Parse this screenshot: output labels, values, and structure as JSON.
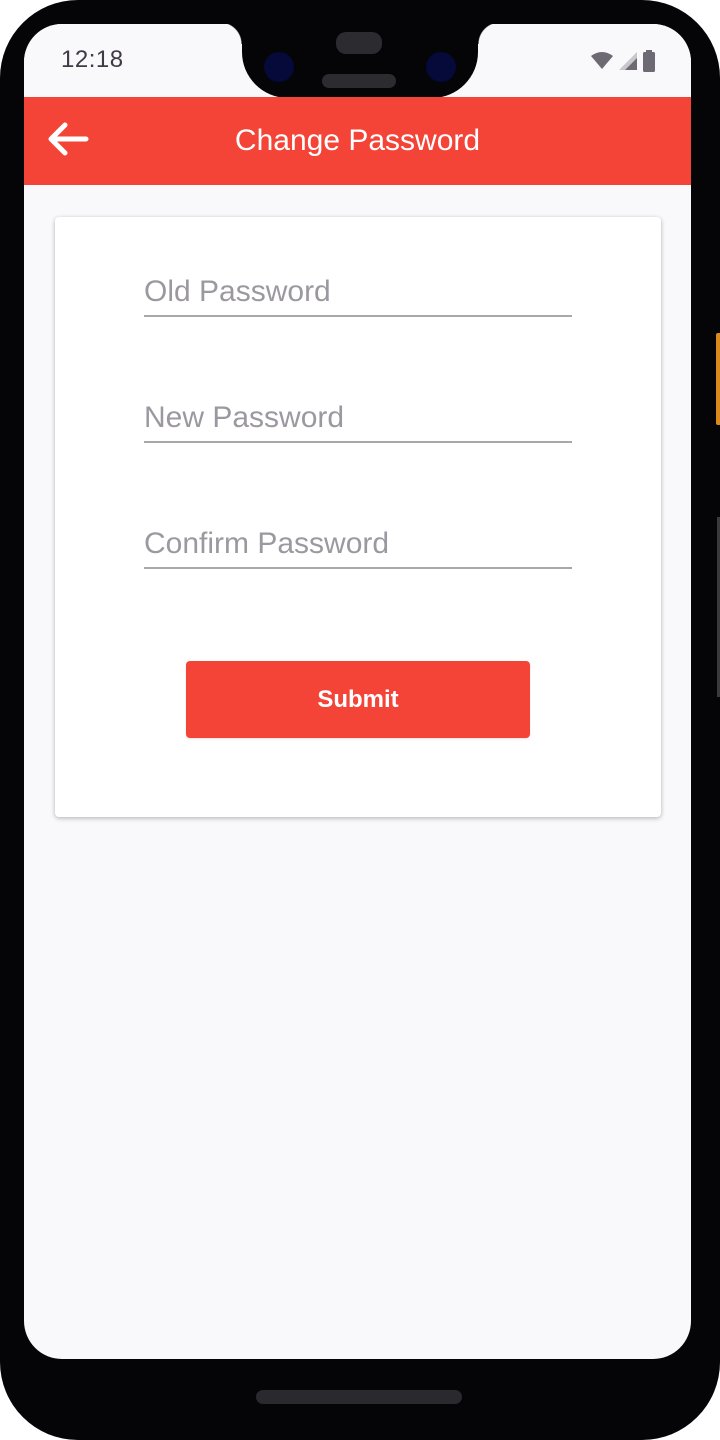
{
  "status_bar": {
    "time": "12:18",
    "icons": [
      "wifi-icon",
      "cellular-signal-icon",
      "battery-icon"
    ]
  },
  "app_bar": {
    "title": "Change Password",
    "back_icon": "arrow-left-icon"
  },
  "form": {
    "old_password": {
      "placeholder": "Old Password",
      "value": ""
    },
    "new_password": {
      "placeholder": "New Password",
      "value": ""
    },
    "confirm_password": {
      "placeholder": "Confirm Password",
      "value": ""
    },
    "submit_label": "Submit"
  },
  "colors": {
    "accent": "#f44337",
    "background": "#f9f8fb",
    "card": "#ffffff",
    "input_underline": "#a9a7ac",
    "placeholder": "#9b98a0"
  }
}
